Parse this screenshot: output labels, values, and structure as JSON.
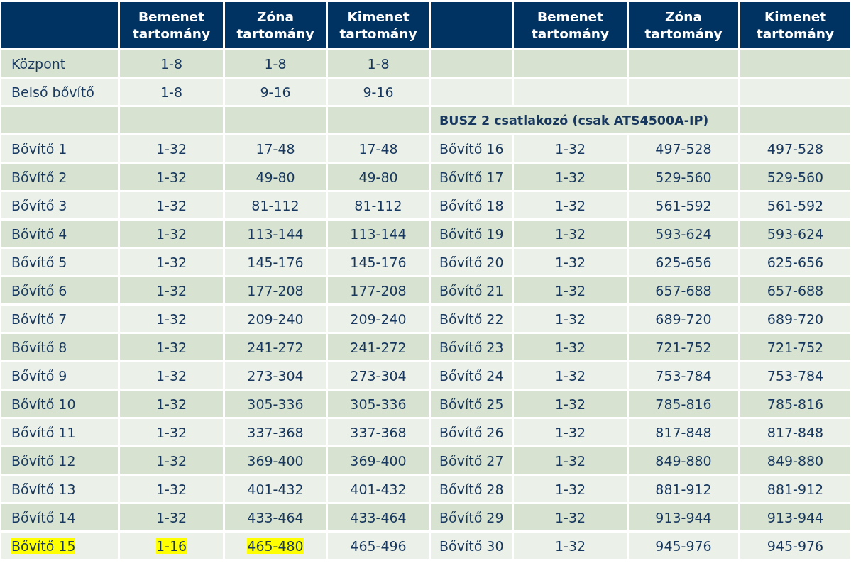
{
  "header": {
    "left": [
      "Bemenet tartomány",
      "Zóna tartomány",
      "Kimenet tartomány"
    ],
    "right": [
      "Bemenet tartomány",
      "Zóna tartomány",
      "Kimenet tartomány"
    ]
  },
  "rows": [
    {
      "kind": "data",
      "left": [
        {
          "text": "Központ",
          "highlighted": false
        },
        {
          "text": "1-8",
          "highlighted": false
        },
        {
          "text": "1-8",
          "highlighted": false
        },
        {
          "text": "1-8",
          "highlighted": false
        }
      ]
    },
    {
      "kind": "data",
      "left": [
        {
          "text": "Belső bővítő",
          "highlighted": false
        },
        {
          "text": "1-8",
          "highlighted": false
        },
        {
          "text": "9-16",
          "highlighted": false
        },
        {
          "text": "9-16",
          "highlighted": false
        }
      ]
    },
    {
      "kind": "bus",
      "label": "BUSZ 2 csatlakozó (csak ATS4500A-IP)"
    },
    {
      "kind": "data",
      "left": [
        {
          "text": "Bővítő 1",
          "highlighted": false
        },
        {
          "text": "1-32",
          "highlighted": false
        },
        {
          "text": "17-48",
          "highlighted": false
        },
        {
          "text": "17-48",
          "highlighted": false
        }
      ],
      "right": [
        {
          "text": "Bővítő 16",
          "highlighted": false
        },
        {
          "text": "1-32",
          "highlighted": false
        },
        {
          "text": "497-528",
          "highlighted": false
        },
        {
          "text": "497-528",
          "highlighted": false
        }
      ]
    },
    {
      "kind": "data",
      "left": [
        {
          "text": "Bővítő 2",
          "highlighted": false
        },
        {
          "text": "1-32",
          "highlighted": false
        },
        {
          "text": "49-80",
          "highlighted": false
        },
        {
          "text": "49-80",
          "highlighted": false
        }
      ],
      "right": [
        {
          "text": "Bővítő 17",
          "highlighted": false
        },
        {
          "text": "1-32",
          "highlighted": false
        },
        {
          "text": "529-560",
          "highlighted": false
        },
        {
          "text": "529-560",
          "highlighted": false
        }
      ]
    },
    {
      "kind": "data",
      "left": [
        {
          "text": "Bővítő 3",
          "highlighted": false
        },
        {
          "text": "1-32",
          "highlighted": false
        },
        {
          "text": "81-112",
          "highlighted": false
        },
        {
          "text": "81-112",
          "highlighted": false
        }
      ],
      "right": [
        {
          "text": "Bővítő 18",
          "highlighted": false
        },
        {
          "text": "1-32",
          "highlighted": false
        },
        {
          "text": "561-592",
          "highlighted": false
        },
        {
          "text": "561-592",
          "highlighted": false
        }
      ]
    },
    {
      "kind": "data",
      "left": [
        {
          "text": "Bővítő 4",
          "highlighted": false
        },
        {
          "text": "1-32",
          "highlighted": false
        },
        {
          "text": "113-144",
          "highlighted": false
        },
        {
          "text": "113-144",
          "highlighted": false
        }
      ],
      "right": [
        {
          "text": "Bővítő 19",
          "highlighted": false
        },
        {
          "text": "1-32",
          "highlighted": false
        },
        {
          "text": "593-624",
          "highlighted": false
        },
        {
          "text": "593-624",
          "highlighted": false
        }
      ]
    },
    {
      "kind": "data",
      "left": [
        {
          "text": "Bővítő 5",
          "highlighted": false
        },
        {
          "text": "1-32",
          "highlighted": false
        },
        {
          "text": "145-176",
          "highlighted": false
        },
        {
          "text": "145-176",
          "highlighted": false
        }
      ],
      "right": [
        {
          "text": "Bővítő 20",
          "highlighted": false
        },
        {
          "text": "1-32",
          "highlighted": false
        },
        {
          "text": "625-656",
          "highlighted": false
        },
        {
          "text": "625-656",
          "highlighted": false
        }
      ]
    },
    {
      "kind": "data",
      "left": [
        {
          "text": "Bővítő 6",
          "highlighted": false
        },
        {
          "text": "1-32",
          "highlighted": false
        },
        {
          "text": "177-208",
          "highlighted": false
        },
        {
          "text": "177-208",
          "highlighted": false
        }
      ],
      "right": [
        {
          "text": "Bővítő 21",
          "highlighted": false
        },
        {
          "text": "1-32",
          "highlighted": false
        },
        {
          "text": "657-688",
          "highlighted": false
        },
        {
          "text": "657-688",
          "highlighted": false
        }
      ]
    },
    {
      "kind": "data",
      "left": [
        {
          "text": "Bővítő 7",
          "highlighted": false
        },
        {
          "text": "1-32",
          "highlighted": false
        },
        {
          "text": "209-240",
          "highlighted": false
        },
        {
          "text": "209-240",
          "highlighted": false
        }
      ],
      "right": [
        {
          "text": "Bővítő 22",
          "highlighted": false
        },
        {
          "text": "1-32",
          "highlighted": false
        },
        {
          "text": "689-720",
          "highlighted": false
        },
        {
          "text": "689-720",
          "highlighted": false
        }
      ]
    },
    {
      "kind": "data",
      "left": [
        {
          "text": "Bővítő 8",
          "highlighted": false
        },
        {
          "text": "1-32",
          "highlighted": false
        },
        {
          "text": "241-272",
          "highlighted": false
        },
        {
          "text": "241-272",
          "highlighted": false
        }
      ],
      "right": [
        {
          "text": "Bővítő 23",
          "highlighted": false
        },
        {
          "text": "1-32",
          "highlighted": false
        },
        {
          "text": "721-752",
          "highlighted": false
        },
        {
          "text": "721-752",
          "highlighted": false
        }
      ]
    },
    {
      "kind": "data",
      "left": [
        {
          "text": "Bővítő 9",
          "highlighted": false
        },
        {
          "text": "1-32",
          "highlighted": false
        },
        {
          "text": "273-304",
          "highlighted": false
        },
        {
          "text": "273-304",
          "highlighted": false
        }
      ],
      "right": [
        {
          "text": "Bővítő 24",
          "highlighted": false
        },
        {
          "text": "1-32",
          "highlighted": false
        },
        {
          "text": "753-784",
          "highlighted": false
        },
        {
          "text": "753-784",
          "highlighted": false
        }
      ]
    },
    {
      "kind": "data",
      "left": [
        {
          "text": "Bővítő 10",
          "highlighted": false
        },
        {
          "text": "1-32",
          "highlighted": false
        },
        {
          "text": "305-336",
          "highlighted": false
        },
        {
          "text": "305-336",
          "highlighted": false
        }
      ],
      "right": [
        {
          "text": "Bővítő 25",
          "highlighted": false
        },
        {
          "text": "1-32",
          "highlighted": false
        },
        {
          "text": "785-816",
          "highlighted": false
        },
        {
          "text": "785-816",
          "highlighted": false
        }
      ]
    },
    {
      "kind": "data",
      "left": [
        {
          "text": "Bővítő 11",
          "highlighted": false
        },
        {
          "text": "1-32",
          "highlighted": false
        },
        {
          "text": "337-368",
          "highlighted": false
        },
        {
          "text": "337-368",
          "highlighted": false
        }
      ],
      "right": [
        {
          "text": "Bővítő 26",
          "highlighted": false
        },
        {
          "text": "1-32",
          "highlighted": false
        },
        {
          "text": "817-848",
          "highlighted": false
        },
        {
          "text": "817-848",
          "highlighted": false
        }
      ]
    },
    {
      "kind": "data",
      "left": [
        {
          "text": "Bővítő 12",
          "highlighted": false
        },
        {
          "text": "1-32",
          "highlighted": false
        },
        {
          "text": "369-400",
          "highlighted": false
        },
        {
          "text": "369-400",
          "highlighted": false
        }
      ],
      "right": [
        {
          "text": "Bővítő 27",
          "highlighted": false
        },
        {
          "text": "1-32",
          "highlighted": false
        },
        {
          "text": "849-880",
          "highlighted": false
        },
        {
          "text": "849-880",
          "highlighted": false
        }
      ]
    },
    {
      "kind": "data",
      "left": [
        {
          "text": "Bővítő 13",
          "highlighted": false
        },
        {
          "text": "1-32",
          "highlighted": false
        },
        {
          "text": "401-432",
          "highlighted": false
        },
        {
          "text": "401-432",
          "highlighted": false
        }
      ],
      "right": [
        {
          "text": "Bővítő 28",
          "highlighted": false
        },
        {
          "text": "1-32",
          "highlighted": false
        },
        {
          "text": "881-912",
          "highlighted": false
        },
        {
          "text": "881-912",
          "highlighted": false
        }
      ]
    },
    {
      "kind": "data",
      "left": [
        {
          "text": "Bővítő 14",
          "highlighted": false
        },
        {
          "text": "1-32",
          "highlighted": false
        },
        {
          "text": "433-464",
          "highlighted": false
        },
        {
          "text": "433-464",
          "highlighted": false
        }
      ],
      "right": [
        {
          "text": "Bővítő 29",
          "highlighted": false
        },
        {
          "text": "1-32",
          "highlighted": false
        },
        {
          "text": "913-944",
          "highlighted": false
        },
        {
          "text": "913-944",
          "highlighted": false
        }
      ]
    },
    {
      "kind": "data",
      "left": [
        {
          "text": "Bővítő 15",
          "highlighted": true
        },
        {
          "text": "1-16",
          "highlighted": true
        },
        {
          "text": "465-480",
          "highlighted": true
        },
        {
          "text": "465-496",
          "highlighted": false
        }
      ],
      "right": [
        {
          "text": "Bővítő 30",
          "highlighted": false
        },
        {
          "text": "1-32",
          "highlighted": false
        },
        {
          "text": "945-976",
          "highlighted": false
        },
        {
          "text": "945-976",
          "highlighted": false
        }
      ]
    }
  ]
}
